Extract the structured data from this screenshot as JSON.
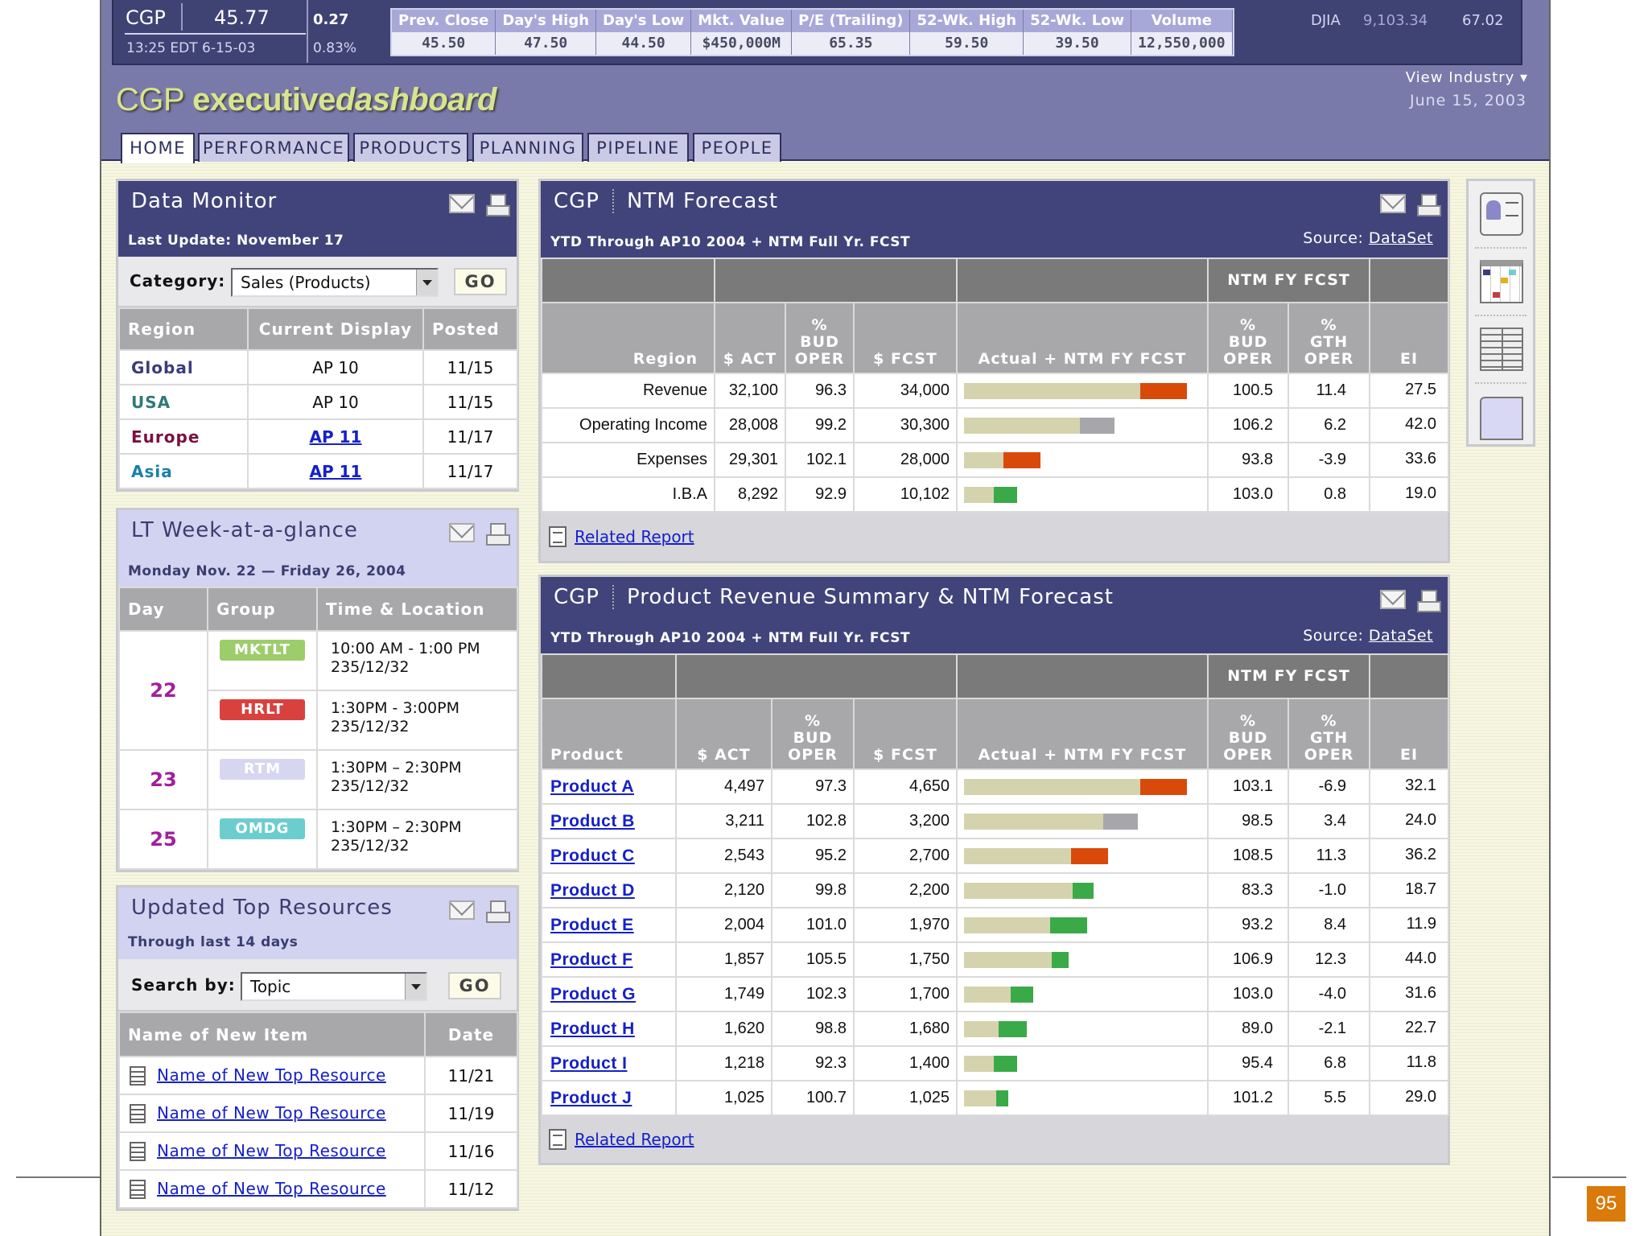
{
  "ticker": {
    "symbol": "CGP",
    "price": "45.77",
    "change": "0.27",
    "pct": "0.83%",
    "time": "13:25 EDT 6-15-03",
    "stats": [
      {
        "label": "Prev. Close",
        "value": "45.50"
      },
      {
        "label": "Day's High",
        "value": "47.50"
      },
      {
        "label": "Day's Low",
        "value": "44.50"
      },
      {
        "label": "Mkt. Value",
        "value": "$450,000M"
      },
      {
        "label": "P/E (Trailing)",
        "value": "65.35"
      },
      {
        "label": "52-Wk. High",
        "value": "59.50"
      },
      {
        "label": "52-Wk. Low",
        "value": "39.50"
      },
      {
        "label": "Volume",
        "value": "12,550,000"
      }
    ],
    "djia_label": "DJIA",
    "djia_value": "9,103.34",
    "djia_change": "67.02"
  },
  "header": {
    "logo_a": "CGP ",
    "logo_b": "executive",
    "logo_c": "dashboard",
    "view_industry": "View Industry ▾",
    "date": "June 15, 2003"
  },
  "tabs": [
    "HOME",
    "PERFORMANCE",
    "PRODUCTS",
    "PLANNING",
    "PIPELINE",
    "PEOPLE"
  ],
  "data_monitor": {
    "title": "Data Monitor",
    "subtitle": "Last Update: November 17",
    "category_label": "Category:",
    "category_value": "Sales (Products)",
    "go": "GO",
    "columns": [
      "Region",
      "Current Display",
      "Posted"
    ],
    "rows": [
      {
        "region": "Global",
        "color": "#3a3d7a",
        "display": "AP 10",
        "link": false,
        "posted": "11/15"
      },
      {
        "region": "USA",
        "color": "#2f7a78",
        "display": "AP 10",
        "link": false,
        "posted": "11/15"
      },
      {
        "region": "Europe",
        "color": "#7a1040",
        "display": "AP 11",
        "link": true,
        "posted": "11/17"
      },
      {
        "region": "Asia",
        "color": "#1a80a8",
        "display": "AP 11",
        "link": true,
        "posted": "11/17"
      }
    ]
  },
  "week": {
    "title": "LT Week-at-a-glance",
    "subtitle": "Monday Nov. 22 — Friday 26, 2004",
    "columns": [
      "Day",
      "Group",
      "Time & Location"
    ],
    "days": [
      {
        "day": "22",
        "events": [
          {
            "group": "MKTLT",
            "color": "#9ccd6a",
            "time": "10:00 AM - 1:00 PM",
            "loc": "235/12/32"
          },
          {
            "group": "HRLT",
            "color": "#d9413f",
            "time": "1:30PM - 3:00PM",
            "loc": "235/12/32"
          }
        ]
      },
      {
        "day": "23",
        "events": [
          {
            "group": "RTM",
            "color": "#d6d6f0",
            "time": "1:30PM – 2:30PM",
            "loc": "235/12/32"
          }
        ]
      },
      {
        "day": "25",
        "events": [
          {
            "group": "OMDG",
            "color": "#6ccdcf",
            "time": "1:30PM – 2:30PM",
            "loc": "235/12/32"
          }
        ]
      }
    ]
  },
  "resources": {
    "title": "Updated Top Resources",
    "subtitle": "Through last 14 days",
    "search_label": "Search by:",
    "search_value": "Topic",
    "go": "GO",
    "columns": [
      "Name of New Item",
      "Date"
    ],
    "rows": [
      {
        "name": "Name of New Top Resource",
        "date": "11/21"
      },
      {
        "name": "Name of New Top Resource",
        "date": "11/19"
      },
      {
        "name": "Name of New Top Resource",
        "date": "11/16"
      },
      {
        "name": "Name of New Top Resource",
        "date": "11/12"
      }
    ]
  },
  "colors": {
    "orange": "#d94a0a",
    "gray": "#a7a7ab",
    "green": "#3aaa48",
    "beige": "#d4d3ad"
  },
  "ntm": {
    "company": "CGP",
    "title": "NTM Forecast",
    "subtitle": "YTD Through AP10 2004 + NTM Full Yr. FCST",
    "source_label": "Source:",
    "source_link": "DataSet",
    "group_header": "NTM  FY FCST",
    "columns": [
      "Region",
      "$ ACT",
      "%\nBUD\nOPER",
      "$ FCST",
      "Actual + NTM FY FCST",
      "%\nBUD\nOPER",
      "%\nGTH\nOPER",
      "EI"
    ],
    "rows": [
      {
        "name": "Revenue",
        "act": "32,100",
        "bud": "96.3",
        "fcst": "34,000",
        "actual_frac": 0.76,
        "total_frac": 0.96,
        "color": "orange",
        "nbud": "100.5",
        "gth": "11.4",
        "ei": "27.5"
      },
      {
        "name": "Operating Income",
        "act": "28,008",
        "bud": "99.2",
        "fcst": "30,300",
        "actual_frac": 0.5,
        "total_frac": 0.65,
        "color": "gray",
        "nbud": "106.2",
        "gth": "6.2",
        "ei": "42.0"
      },
      {
        "name": "Expenses",
        "act": "29,301",
        "bud": "102.1",
        "fcst": "28,000",
        "actual_frac": 0.17,
        "total_frac": 0.33,
        "color": "orange",
        "nbud": "93.8",
        "gth": "-3.9",
        "ei": "33.6"
      },
      {
        "name": "I.B.A",
        "act": "8,292",
        "bud": "92.9",
        "fcst": "10,102",
        "actual_frac": 0.13,
        "total_frac": 0.23,
        "color": "green",
        "nbud": "103.0",
        "gth": "0.8",
        "ei": "19.0"
      }
    ],
    "related": "Related Report"
  },
  "products": {
    "company": "CGP",
    "title": "Product Revenue Summary & NTM Forecast",
    "subtitle": "YTD Through AP10 2004 + NTM Full Yr. FCST",
    "source_label": "Source:",
    "source_link": "DataSet",
    "group_header": "NTM  FY FCST",
    "columns": [
      "Product",
      "$ ACT",
      "%\nBUD\nOPER",
      "$ FCST",
      "Actual + NTM FY FCST",
      "%\nBUD\nOPER",
      "%\nGTH\nOPER",
      "EI"
    ],
    "rows": [
      {
        "name": "Product A",
        "act": "4,497",
        "bud": "97.3",
        "fcst": "4,650",
        "actual_frac": 0.76,
        "total_frac": 0.96,
        "color": "orange",
        "nbud": "103.1",
        "gth": "-6.9",
        "ei": "32.1"
      },
      {
        "name": "Product B",
        "act": "3,211",
        "bud": "102.8",
        "fcst": "3,200",
        "actual_frac": 0.6,
        "total_frac": 0.75,
        "color": "gray",
        "nbud": "98.5",
        "gth": "3.4",
        "ei": "24.0"
      },
      {
        "name": "Product C",
        "act": "2,543",
        "bud": "95.2",
        "fcst": "2,700",
        "actual_frac": 0.46,
        "total_frac": 0.62,
        "color": "orange",
        "nbud": "108.5",
        "gth": "11.3",
        "ei": "36.2"
      },
      {
        "name": "Product D",
        "act": "2,120",
        "bud": "99.8",
        "fcst": "2,200",
        "actual_frac": 0.47,
        "total_frac": 0.56,
        "color": "green",
        "nbud": "83.3",
        "gth": "-1.0",
        "ei": "18.7"
      },
      {
        "name": "Product E",
        "act": "2,004",
        "bud": "101.0",
        "fcst": "1,970",
        "actual_frac": 0.37,
        "total_frac": 0.53,
        "color": "green",
        "nbud": "93.2",
        "gth": "8.4",
        "ei": "11.9"
      },
      {
        "name": "Product F",
        "act": "1,857",
        "bud": "105.5",
        "fcst": "1,750",
        "actual_frac": 0.38,
        "total_frac": 0.45,
        "color": "green",
        "nbud": "106.9",
        "gth": "12.3",
        "ei": "44.0"
      },
      {
        "name": "Product G",
        "act": "1,749",
        "bud": "102.3",
        "fcst": "1,700",
        "actual_frac": 0.2,
        "total_frac": 0.3,
        "color": "green",
        "nbud": "103.0",
        "gth": "-4.0",
        "ei": "31.6"
      },
      {
        "name": "Product H",
        "act": "1,620",
        "bud": "98.8",
        "fcst": "1,680",
        "actual_frac": 0.15,
        "total_frac": 0.27,
        "color": "green",
        "nbud": "89.0",
        "gth": "-2.1",
        "ei": "22.7"
      },
      {
        "name": "Product I",
        "act": "1,218",
        "bud": "92.3",
        "fcst": "1,400",
        "actual_frac": 0.13,
        "total_frac": 0.23,
        "color": "green",
        "nbud": "95.4",
        "gth": "6.8",
        "ei": "11.8"
      },
      {
        "name": "Product J",
        "act": "1,025",
        "bud": "100.7",
        "fcst": "1,025",
        "actual_frac": 0.14,
        "total_frac": 0.19,
        "color": "green",
        "nbud": "101.2",
        "gth": "5.5",
        "ei": "29.0"
      }
    ],
    "related": "Related Report"
  },
  "page_number": "95"
}
